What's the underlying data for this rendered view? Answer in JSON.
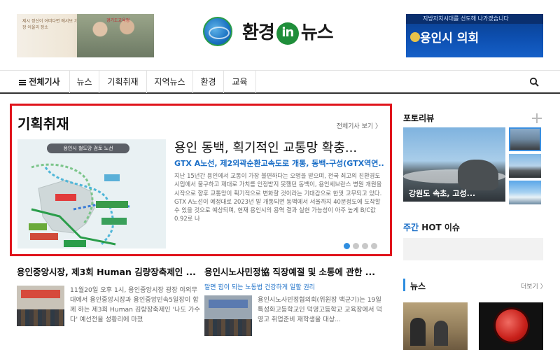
{
  "header": {
    "left_banner": {
      "text": "제시 정신이 어떠다면 에서보 가장 어울리 장소",
      "brand": "경기도교육청"
    },
    "logo": {
      "part1": "환경",
      "part2": "in",
      "part3": "뉴스",
      "globe_label": "ENVIRONMENT NEWS"
    },
    "right_banner": {
      "top_text": "지방자치시대를 선도해 나가겠습니다",
      "main_text": "용인시 의회"
    }
  },
  "nav": {
    "all_label": "전체기사",
    "items": [
      "뉴스",
      "기획취재",
      "지역뉴스",
      "환경",
      "교육"
    ]
  },
  "feature": {
    "section_title": "기획취재",
    "more_label": "전체기사 보기 〉",
    "map_title": "용인시 철도망 검토 노선",
    "headline": "용인 동백, 획기적인 교통망 확충...",
    "subtitle": "GTX A노선, 제2외곽순환고속도로 개통, 동백-구성(GTX역연...",
    "body": "지난 15년간 용인에서 교통이 가장 불편하다는 오명을 받으며, 전국 최고의 친환경도시입에서 불구하고 제대로 가치를 인정받지 못했던 동백이, 용인세브란스 병원 개원을 시작으로 향후 교통망이 획기적으로 변화할 것이라는 기대감으로 한껏 고무되고 있다. GTX A노선이 예정대로 2023년 말 개통되면 동백에서 서울까지 40분정도에 도착할 수 있을 것으로 예상되며, 현재 용인시의 용역 결과 실현 가능성이 아주 높게 B/C값 0.92로 나",
    "dots": 4,
    "active_dot": 1
  },
  "articles": [
    {
      "headline": "용인중앙시장, 제3회 Human 김량장축제인 ...",
      "subtitle": "",
      "snippet": "11월20일 오후 1시, 용인중앙시장 광장 야외무대에서 용인중앙시장과 용인중앙민속5일장이 함께 하는 제3회 Human 김량장축제인 '나도 가수다' 예선전을 성황리에 마쳤"
    },
    {
      "headline": "용인시노사민정協 직장예절 및 소통에 관한 ...",
      "subtitle": "말면 힘이 되는 노동법 건강하게 일할 권리",
      "snippet": "용인시노사민정협의회(위원장 백군기)는 19일 특성화고등학교인 덕영고등학교 교육장에서 덕영고 취업준비 재학생을 대상..."
    }
  ],
  "sidebar": {
    "photo_title": "포토리뷰",
    "photo_caption": "강원도 속초, 고성...",
    "hot_prefix": "주간",
    "hot_label": "HOT 이슈",
    "news_title": "뉴스",
    "news_more": "더보기 〉"
  },
  "colors": {
    "highlight_border": "#e0141c",
    "accent_blue": "#1a6ec7",
    "logo_green": "#1f8e3a"
  }
}
